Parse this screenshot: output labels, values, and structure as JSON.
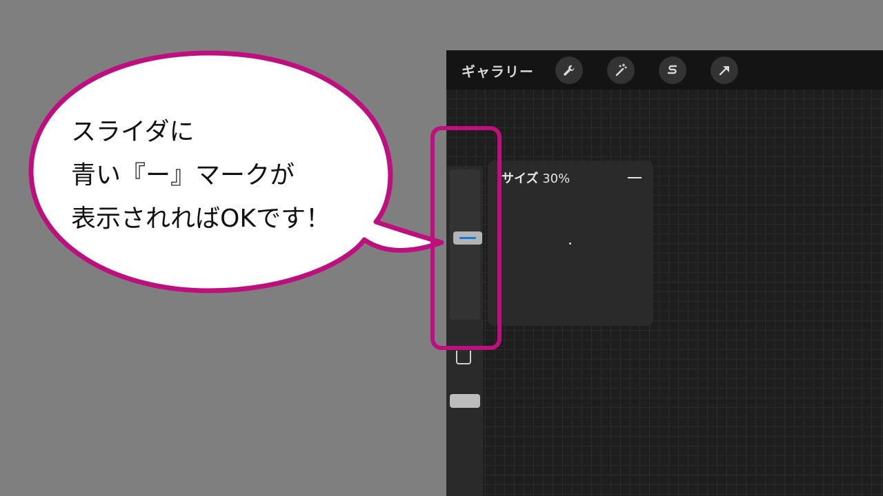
{
  "app": {
    "gallery_label": "ギャラリー",
    "toolbar_icons": [
      "wrench-icon",
      "magic-wand-icon",
      "selection-s-icon",
      "transform-arrow-icon"
    ]
  },
  "sidebar": {
    "slider_thumb_marker_color": "#1673e8"
  },
  "size_popup": {
    "label": "サイズ",
    "value": "30%",
    "minus_symbol": "—"
  },
  "callout": {
    "lines": [
      "スライダに",
      "青い『ー』マークが",
      "表示されればOKです！"
    ],
    "accent_color": "#be0f7e"
  }
}
